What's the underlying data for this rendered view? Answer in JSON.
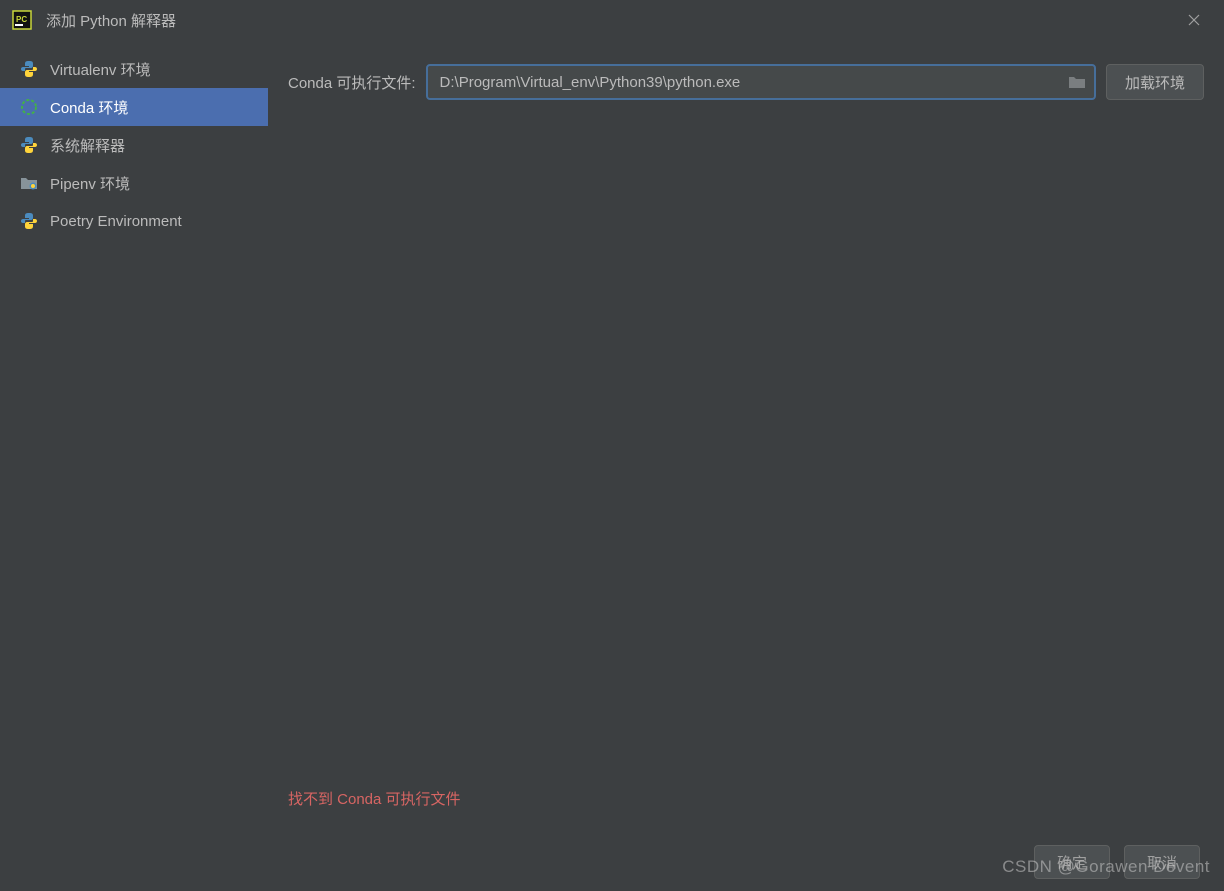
{
  "titlebar": {
    "title": "添加 Python 解释器"
  },
  "sidebar": {
    "items": [
      {
        "label": "Virtualenv 环境",
        "icon": "python-icon"
      },
      {
        "label": "Conda 环境",
        "icon": "conda-icon",
        "selected": true
      },
      {
        "label": "系统解释器",
        "icon": "python-icon"
      },
      {
        "label": "Pipenv 环境",
        "icon": "folder-icon"
      },
      {
        "label": "Poetry Environment",
        "icon": "python-icon"
      }
    ]
  },
  "main": {
    "conda_exec_label": "Conda 可执行文件:",
    "conda_exec_value": "D:\\Program\\Virtual_env\\Python39\\python.exe",
    "load_env_label": "加载环境",
    "error_message": "找不到 Conda 可执行文件"
  },
  "buttons": {
    "ok": "确定",
    "cancel": "取消"
  },
  "watermark": "CSDN @Gorawen Devent"
}
